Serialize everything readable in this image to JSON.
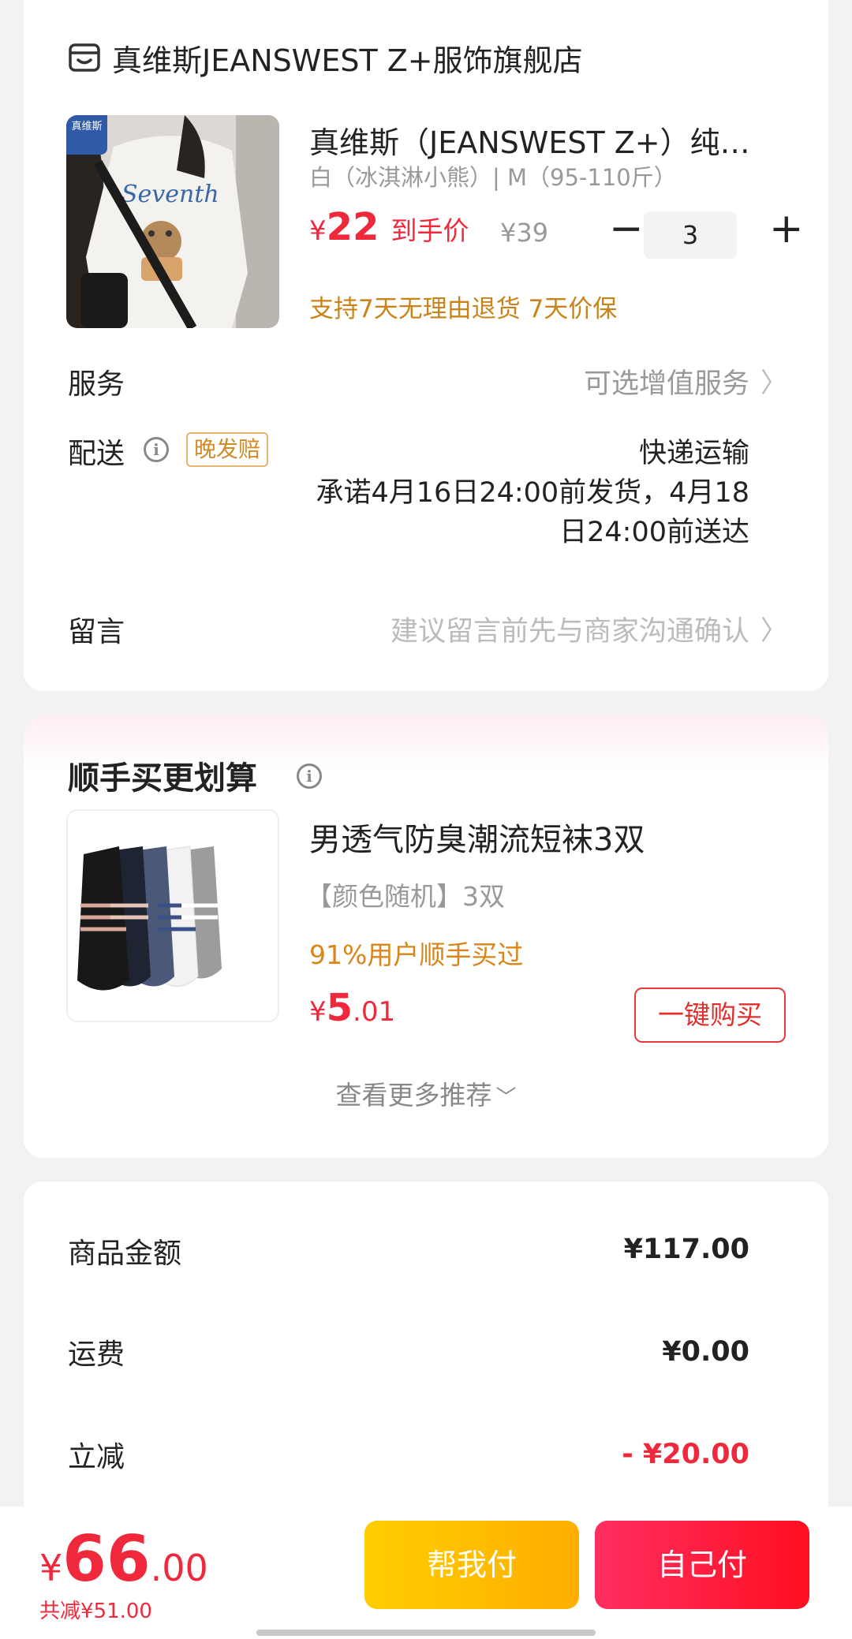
{
  "store": {
    "name": "真维斯JEANSWEST Z+服饰旗舰店",
    "icon": "store-icon"
  },
  "product": {
    "title": "真维斯（JEANSWEST Z+）纯棉短袖T恤",
    "title_display": "真维斯（JEANSWEST Z+）纯棉…",
    "sku": "白（冰淇淋小熊）| M（95-110斤）",
    "price_symbol": "¥",
    "price": "22",
    "price_label": "到手价",
    "original_price": "¥39",
    "quantity": "3",
    "minus": "−",
    "plus": "+",
    "guarantee": "支持7天无理由退货  7天价保",
    "image_badge": "真维斯"
  },
  "service": {
    "label": "服务",
    "value": "可选增值服务",
    "chevron": "〉"
  },
  "delivery": {
    "label": "配送",
    "badge": "晚发赔",
    "method": "快递运输",
    "promise_line1": "承诺4月16日24:00前发货，4月18",
    "promise_line2": "日24:00前送达"
  },
  "message": {
    "label": "留言",
    "placeholder": "建议留言前先与商家沟通确认",
    "chevron": "〉"
  },
  "recommend": {
    "title": "顺手买更划算",
    "item": {
      "name": "男透气防臭潮流短袜3双",
      "spec": "【颜色随机】3双",
      "bought": "91%用户顺手买过",
      "price_symbol": "¥",
      "price_int": "5",
      "price_dec": ".01",
      "buy_label": "一键购买"
    },
    "more": "查看更多推荐",
    "more_icon": "chevron-down-icon"
  },
  "summary": {
    "goods_label": "商品金额",
    "goods_value": "¥117.00",
    "shipping_label": "运费",
    "shipping_value": "¥0.00",
    "discount_label": "立减",
    "discount_value": "- ¥20.00"
  },
  "bottom": {
    "total_symbol": "¥",
    "total_int": "66",
    "total_dec": ".00",
    "total_saved": "共减¥51.00",
    "help_pay": "帮我付",
    "self_pay": "自己付"
  },
  "colors": {
    "price_red": "#f0283c",
    "guarantee_orange": "#c98318",
    "help_button": "#ffb800",
    "self_button": "#ff1f3d"
  }
}
